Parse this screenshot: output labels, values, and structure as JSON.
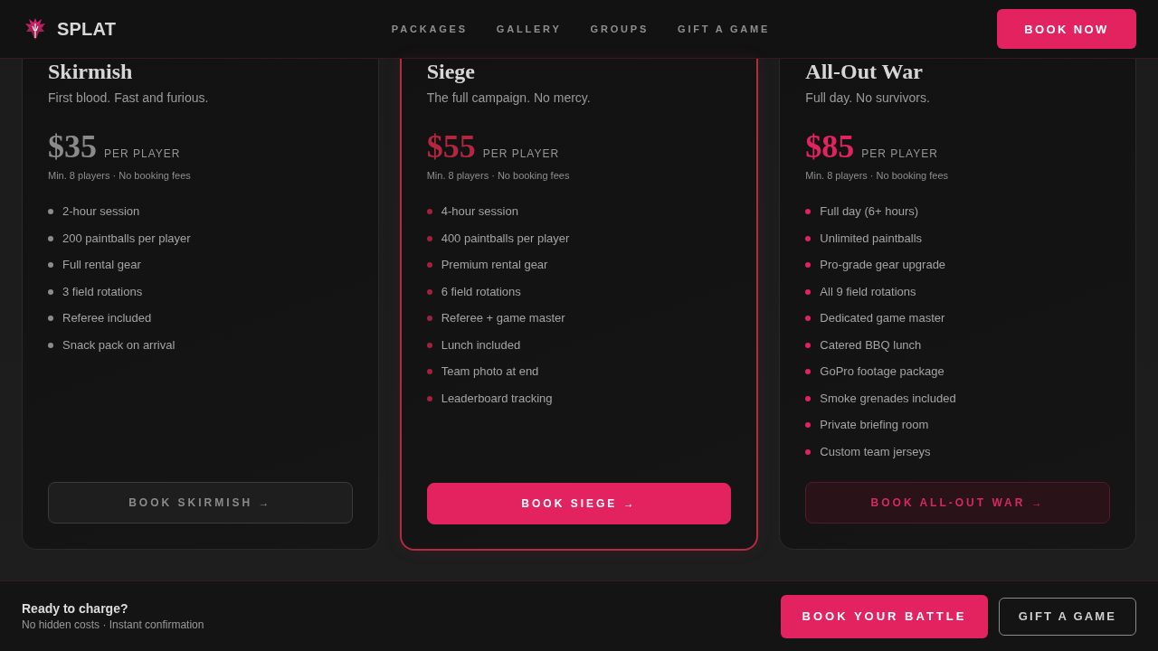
{
  "header": {
    "brand": "SPLAT",
    "nav": [
      "PACKAGES",
      "GALLERY",
      "GROUPS",
      "GIFT A GAME"
    ],
    "cta": "BOOK NOW"
  },
  "packages": [
    {
      "kind": "basic",
      "title": "Skirmish",
      "tagline": "First blood. Fast and furious.",
      "price": "$35",
      "unit": "PER PLAYER",
      "note": "Min. 8 players · No booking fees",
      "features": [
        "2-hour session",
        "200 paintballs per player",
        "Full rental gear",
        "3 field rotations",
        "Referee included",
        "Snack pack on arrival"
      ],
      "button": "BOOK SKIRMISH →"
    },
    {
      "kind": "featured",
      "title": "Siege",
      "tagline": "The full campaign. No mercy.",
      "price": "$55",
      "unit": "PER PLAYER",
      "note": "Min. 8 players · No booking fees",
      "features": [
        "4-hour session",
        "400 paintballs per player",
        "Premium rental gear",
        "6 field rotations",
        "Referee + game master",
        "Lunch included",
        "Team photo at end",
        "Leaderboard tracking"
      ],
      "button": "BOOK SIEGE →"
    },
    {
      "kind": "premium",
      "title": "All-Out War",
      "tagline": "Full day. No survivors.",
      "price": "$85",
      "unit": "PER PLAYER",
      "note": "Min. 8 players · No booking fees",
      "features": [
        "Full day (6+ hours)",
        "Unlimited paintballs",
        "Pro-grade gear upgrade",
        "All 9 field rotations",
        "Dedicated game master",
        "Catered BBQ lunch",
        "GoPro footage package",
        "Smoke grenades included",
        "Private briefing room",
        "Custom team jerseys"
      ],
      "button": "BOOK ALL-OUT WAR →"
    }
  ],
  "footer": {
    "heading": "Ready to charge?",
    "subtext": "No hidden costs · Instant confirmation",
    "buttons": [
      {
        "kind": "primary",
        "label": "BOOK YOUR BATTLE"
      },
      {
        "kind": "outline",
        "label": "GIFT A GAME"
      }
    ]
  }
}
